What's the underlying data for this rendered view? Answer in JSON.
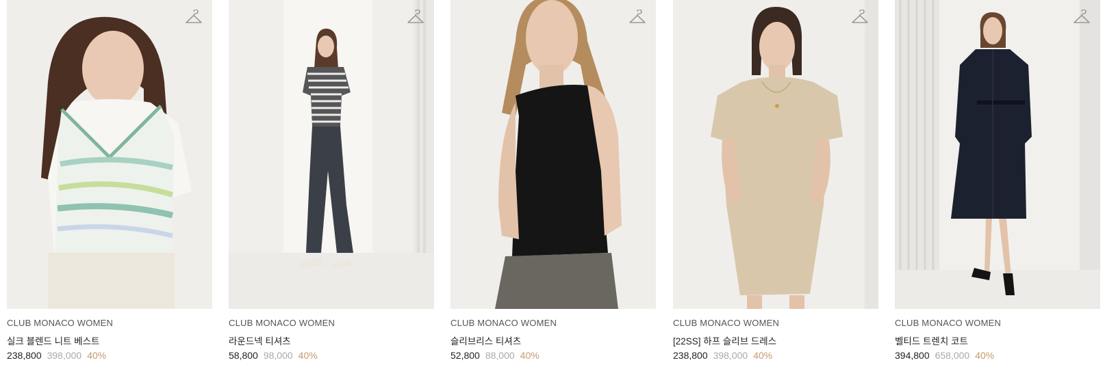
{
  "products": [
    {
      "brand": "CLUB MONACO WOMEN",
      "name": "실크 블렌드 니트 베스트",
      "price": "238,800",
      "original_price": "398,000",
      "discount": "40%",
      "icon": "hanger-icon"
    },
    {
      "brand": "CLUB MONACO WOMEN",
      "name": "라운드넥 티셔츠",
      "price": "58,800",
      "original_price": "98,000",
      "discount": "40%",
      "icon": "hanger-icon"
    },
    {
      "brand": "CLUB MONACO WOMEN",
      "name": "슬리브리스 티셔츠",
      "price": "52,800",
      "original_price": "88,000",
      "discount": "40%",
      "icon": "hanger-icon"
    },
    {
      "brand": "CLUB MONACO WOMEN",
      "name": "[22SS] 하프 슬리브 드레스",
      "price": "238,800",
      "original_price": "398,000",
      "discount": "40%",
      "icon": "hanger-icon"
    },
    {
      "brand": "CLUB MONACO WOMEN",
      "name": "벨티드 트렌치 코트",
      "price": "394,800",
      "original_price": "658,000",
      "discount": "40%",
      "icon": "hanger-icon"
    }
  ],
  "colors": {
    "discount": "#c49a6c",
    "original_price": "#a9a9a9",
    "text": "#222222"
  }
}
